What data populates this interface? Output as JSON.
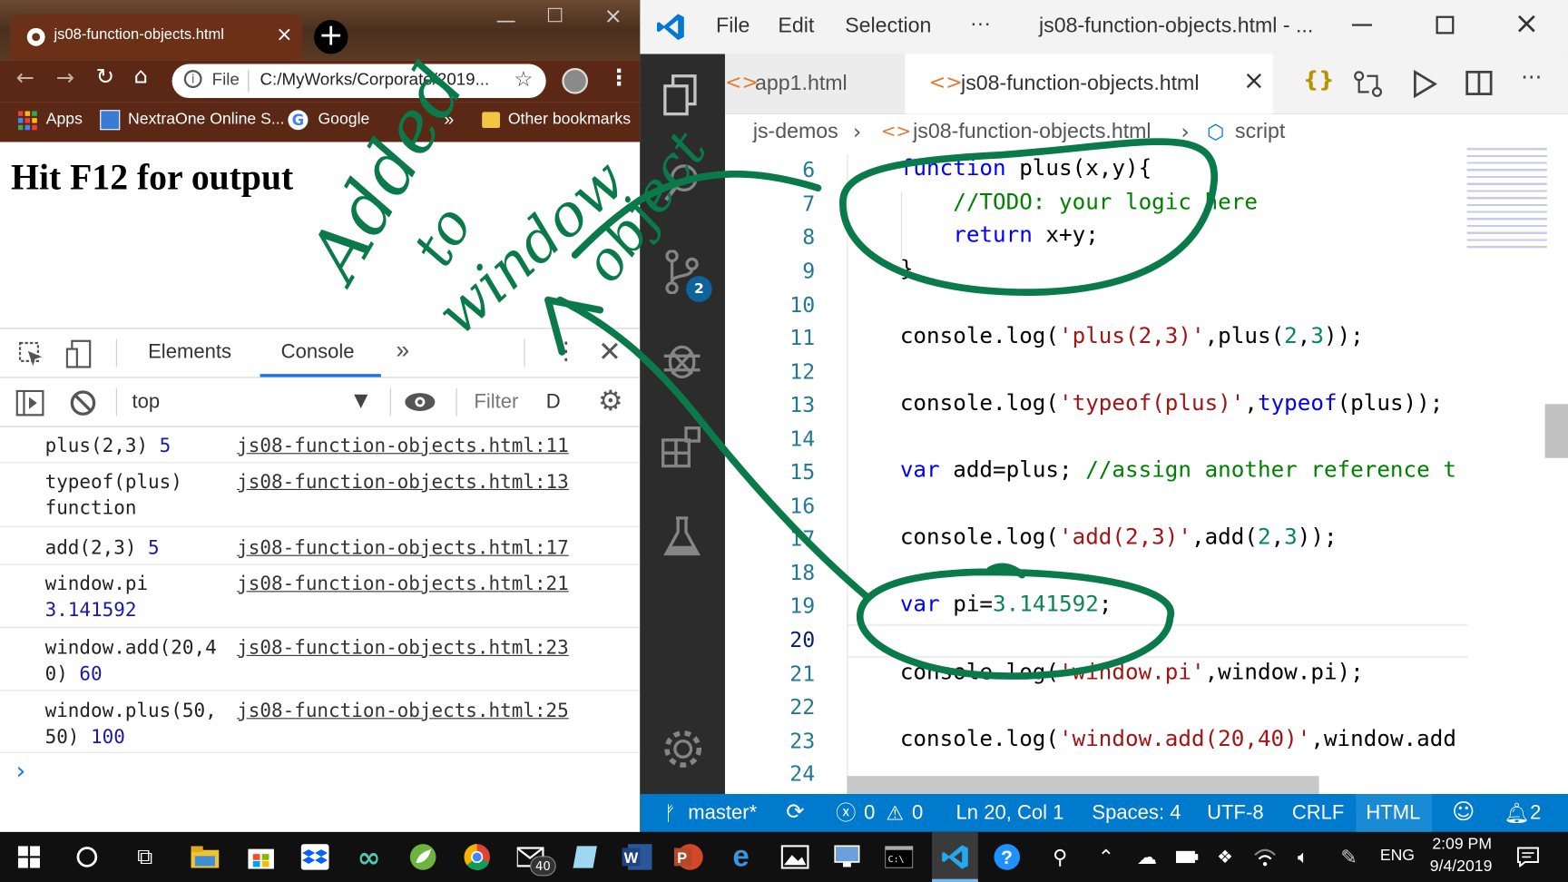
{
  "browser": {
    "tab_title": "js08-function-objects.html",
    "address_label": "File",
    "address_value": "C:/MyWorks/Corporate/2019...",
    "bookmarks": [
      "Apps",
      "NextraOne Online S...",
      "Google"
    ],
    "bookmarks_more": "»",
    "other_bookmarks": "Other bookmarks",
    "page_heading": "Hit F12 for output"
  },
  "devtools": {
    "tabs": [
      "Elements",
      "Console"
    ],
    "more": "»",
    "context": "top",
    "filter_placeholder": "Filter",
    "level_label": "D",
    "console_rows": [
      {
        "text1": "plus(2,3) ",
        "num1": "5",
        "text2": "",
        "num2": "",
        "source": "js08-function-objects.html:11"
      },
      {
        "text1": "typeof(plus)",
        "num1": "",
        "text2": "function",
        "num2": "",
        "source": "js08-function-objects.html:13"
      },
      {
        "text1": "add(2,3) ",
        "num1": "5",
        "text2": "",
        "num2": "",
        "source": "js08-function-objects.html:17"
      },
      {
        "text1": "window.pi",
        "num1": "",
        "text2": "",
        "num2": "3.141592",
        "source": "js08-function-objects.html:21"
      },
      {
        "text1": "window.add(20,4",
        "num1": "",
        "text2": "0) ",
        "num2": "60",
        "source": "js08-function-objects.html:23"
      },
      {
        "text1": "window.plus(50,",
        "num1": "",
        "text2": "50) ",
        "num2": "100",
        "source": "js08-function-objects.html:25"
      }
    ],
    "prompt": "›"
  },
  "vscode": {
    "menu": [
      "File",
      "Edit",
      "Selection",
      "···"
    ],
    "window_title": "js08-function-objects.html - ...",
    "tabs": [
      "app1.html",
      "js08-function-objects.html"
    ],
    "breadcrumb": [
      "js-demos",
      "js08-function-objects.html",
      "script"
    ],
    "scm_badge": "2",
    "line_numbers": [
      "6",
      "7",
      "8",
      "9",
      "10",
      "11",
      "12",
      "13",
      "14",
      "15",
      "16",
      "17",
      "18",
      "19",
      "20",
      "21",
      "22",
      "23",
      "24"
    ],
    "status": {
      "branch": "master*",
      "errors": "0",
      "warnings": "0",
      "position": "Ln 20, Col 1",
      "spaces": "Spaces: 4",
      "encoding": "UTF-8",
      "eol": "CRLF",
      "language": "HTML",
      "notifications": "2"
    }
  },
  "code": {
    "l6a": "function",
    "l6b": " plus(x,y){",
    "l7": "    //TODO: your logic here",
    "l8a": "    return",
    "l8b": " x+y;",
    "l9": "}",
    "l11a": "console.log(",
    "l11b": "'plus(2,3)'",
    "l11c": ",plus(",
    "l11d": "2",
    "l11e": ",",
    "l11f": "3",
    "l11g": "));",
    "l13a": "console.log(",
    "l13b": "'typeof(plus)'",
    "l13c": ",",
    "l13d": "typeof",
    "l13e": "(plus));",
    "l15a": "var",
    "l15b": " add=plus; ",
    "l15c": "//assign another reference t",
    "l17a": "console.log(",
    "l17b": "'add(2,3)'",
    "l17c": ",add(",
    "l17d": "2",
    "l17e": ",",
    "l17f": "3",
    "l17g": "));",
    "l19a": "var",
    "l19b": " pi=",
    "l19c": "3.141592",
    "l19d": ";",
    "l21a": "console.log(",
    "l21b": "'window.pi'",
    "l21c": ",window.pi);",
    "l23a": "console.log(",
    "l23b": "'window.add(20,40)'",
    "l23c": ",window.add"
  },
  "annotation": {
    "line1": "Added",
    "line2": "to",
    "line3": "window",
    "line4": "object"
  },
  "taskbar": {
    "mail_badge": "40",
    "language": "ENG",
    "time": "2:09 PM",
    "date": "9/4/2019"
  },
  "colors": {
    "vscode_blue": "#007acc",
    "ink_green": "#0a7a4a",
    "chrome_tab": "#6a3018"
  }
}
